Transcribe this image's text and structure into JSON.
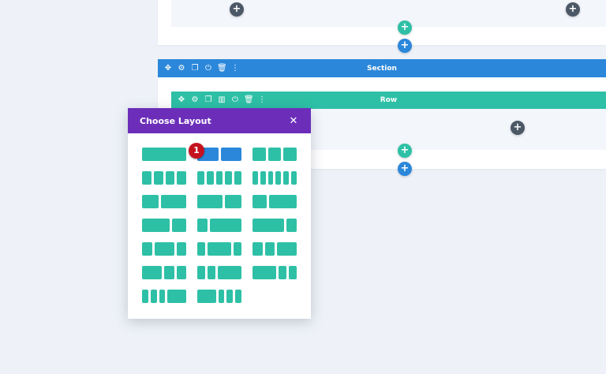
{
  "section": {
    "label": "Section"
  },
  "row": {
    "label": "Row"
  },
  "add_symbol": "+",
  "toolbar_icons": [
    "move-icon",
    "gear-icon",
    "duplicate-icon",
    "columns-icon",
    "power-icon",
    "trash-icon",
    "more-icon"
  ],
  "modal": {
    "title": "Choose Layout",
    "close_symbol": "✕",
    "layouts": [
      {
        "id": "1",
        "cols": [
          4
        ]
      },
      {
        "id": "1/2-1/2",
        "cols": [
          2,
          2
        ],
        "selected": true
      },
      {
        "id": "1/3-1/3-1/3",
        "cols": [
          1,
          1,
          1
        ]
      },
      {
        "id": "1/4x4",
        "cols": [
          1,
          1,
          1,
          1
        ]
      },
      {
        "id": "1/5x5",
        "cols": [
          1,
          1,
          1,
          1,
          1
        ]
      },
      {
        "id": "1/6x6",
        "cols": [
          1,
          1,
          1,
          1,
          1,
          1
        ]
      },
      {
        "id": "2/5-3/5",
        "cols": [
          2,
          3
        ]
      },
      {
        "id": "3/5-2/5",
        "cols": [
          3,
          2
        ]
      },
      {
        "id": "1/3-2/3",
        "cols": [
          1,
          2
        ]
      },
      {
        "id": "2/3-1/3",
        "cols": [
          2,
          1
        ]
      },
      {
        "id": "1/4-3/4",
        "cols": [
          1,
          3
        ]
      },
      {
        "id": "3/4-1/4",
        "cols": [
          3,
          1
        ]
      },
      {
        "id": "1/4-1/2-1/4",
        "cols": [
          1,
          2,
          1
        ]
      },
      {
        "id": "1/5-3/5-1/5",
        "cols": [
          1,
          3,
          1
        ]
      },
      {
        "id": "1/4-1/4-1/2",
        "cols": [
          1,
          1,
          2
        ]
      },
      {
        "id": "1/2-1/4-1/4",
        "cols": [
          2,
          1,
          1
        ]
      },
      {
        "id": "1/5-1/5-3/5",
        "cols": [
          1,
          1,
          3
        ]
      },
      {
        "id": "3/5-1/5-1/5",
        "cols": [
          3,
          1,
          1
        ]
      },
      {
        "id": "1/6-1/6-1/6-1/2",
        "cols": [
          1,
          1,
          1,
          3
        ]
      },
      {
        "id": "1/2-1/6-1/6-1/6",
        "cols": [
          3,
          1,
          1,
          1
        ]
      }
    ]
  },
  "badge": {
    "text": "1"
  },
  "colors": {
    "section": "#2b87da",
    "row": "#2ec0a6",
    "modal_header": "#6c2eb9",
    "badge": "#c5121e"
  }
}
